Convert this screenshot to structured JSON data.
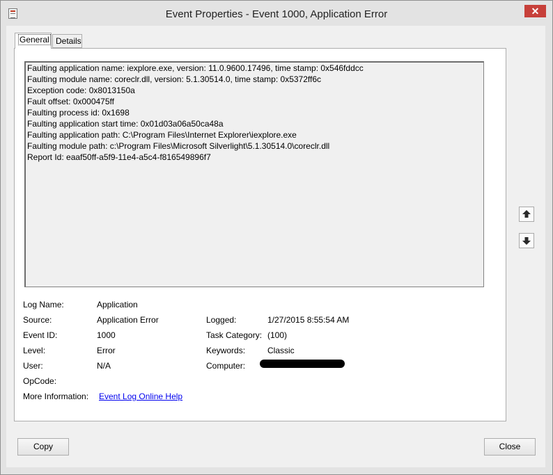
{
  "window": {
    "title": "Event Properties - Event 1000, Application Error",
    "close_glyph": "✕"
  },
  "tabs": [
    {
      "label": "General",
      "selected": true
    },
    {
      "label": "Details",
      "selected": false
    }
  ],
  "description": [
    "Faulting application name: iexplore.exe, version: 11.0.9600.17496, time stamp: 0x546fddcc",
    "Faulting module name: coreclr.dll, version: 5.1.30514.0, time stamp: 0x5372ff6c",
    "Exception code: 0x8013150a",
    "Fault offset: 0x000475ff",
    "Faulting process id: 0x1698",
    "Faulting application start time: 0x01d03a06a50ca48a",
    "Faulting application path: C:\\Program Files\\Internet Explorer\\iexplore.exe",
    "Faulting module path: c:\\Program Files\\Microsoft Silverlight\\5.1.30514.0\\coreclr.dll",
    "Report Id: eaaf50ff-a5f9-11e4-a5c4-f816549896f7"
  ],
  "fields": {
    "log_name": {
      "label": "Log Name:",
      "value": "Application"
    },
    "source": {
      "label": "Source:",
      "value": "Application Error"
    },
    "event_id": {
      "label": "Event ID:",
      "value": "1000"
    },
    "level": {
      "label": "Level:",
      "value": "Error"
    },
    "user": {
      "label": "User:",
      "value": "N/A"
    },
    "opcode": {
      "label": "OpCode:",
      "value": ""
    },
    "more_info": {
      "label": "More Information:",
      "link": "Event Log Online Help"
    },
    "logged": {
      "label": "Logged:",
      "value": "1/27/2015 8:55:54 AM"
    },
    "task_category": {
      "label": "Task Category:",
      "value": "(100)"
    },
    "keywords": {
      "label": "Keywords:",
      "value": "Classic"
    },
    "computer": {
      "label": "Computer:",
      "value": ""
    }
  },
  "buttons": {
    "copy": "Copy",
    "close": "Close"
  },
  "icons": [
    "app-event-icon",
    "close-icon",
    "arrow-up-icon",
    "arrow-down-icon"
  ],
  "colors": {
    "link": "#0000ee",
    "close_button": "#c7403a"
  }
}
